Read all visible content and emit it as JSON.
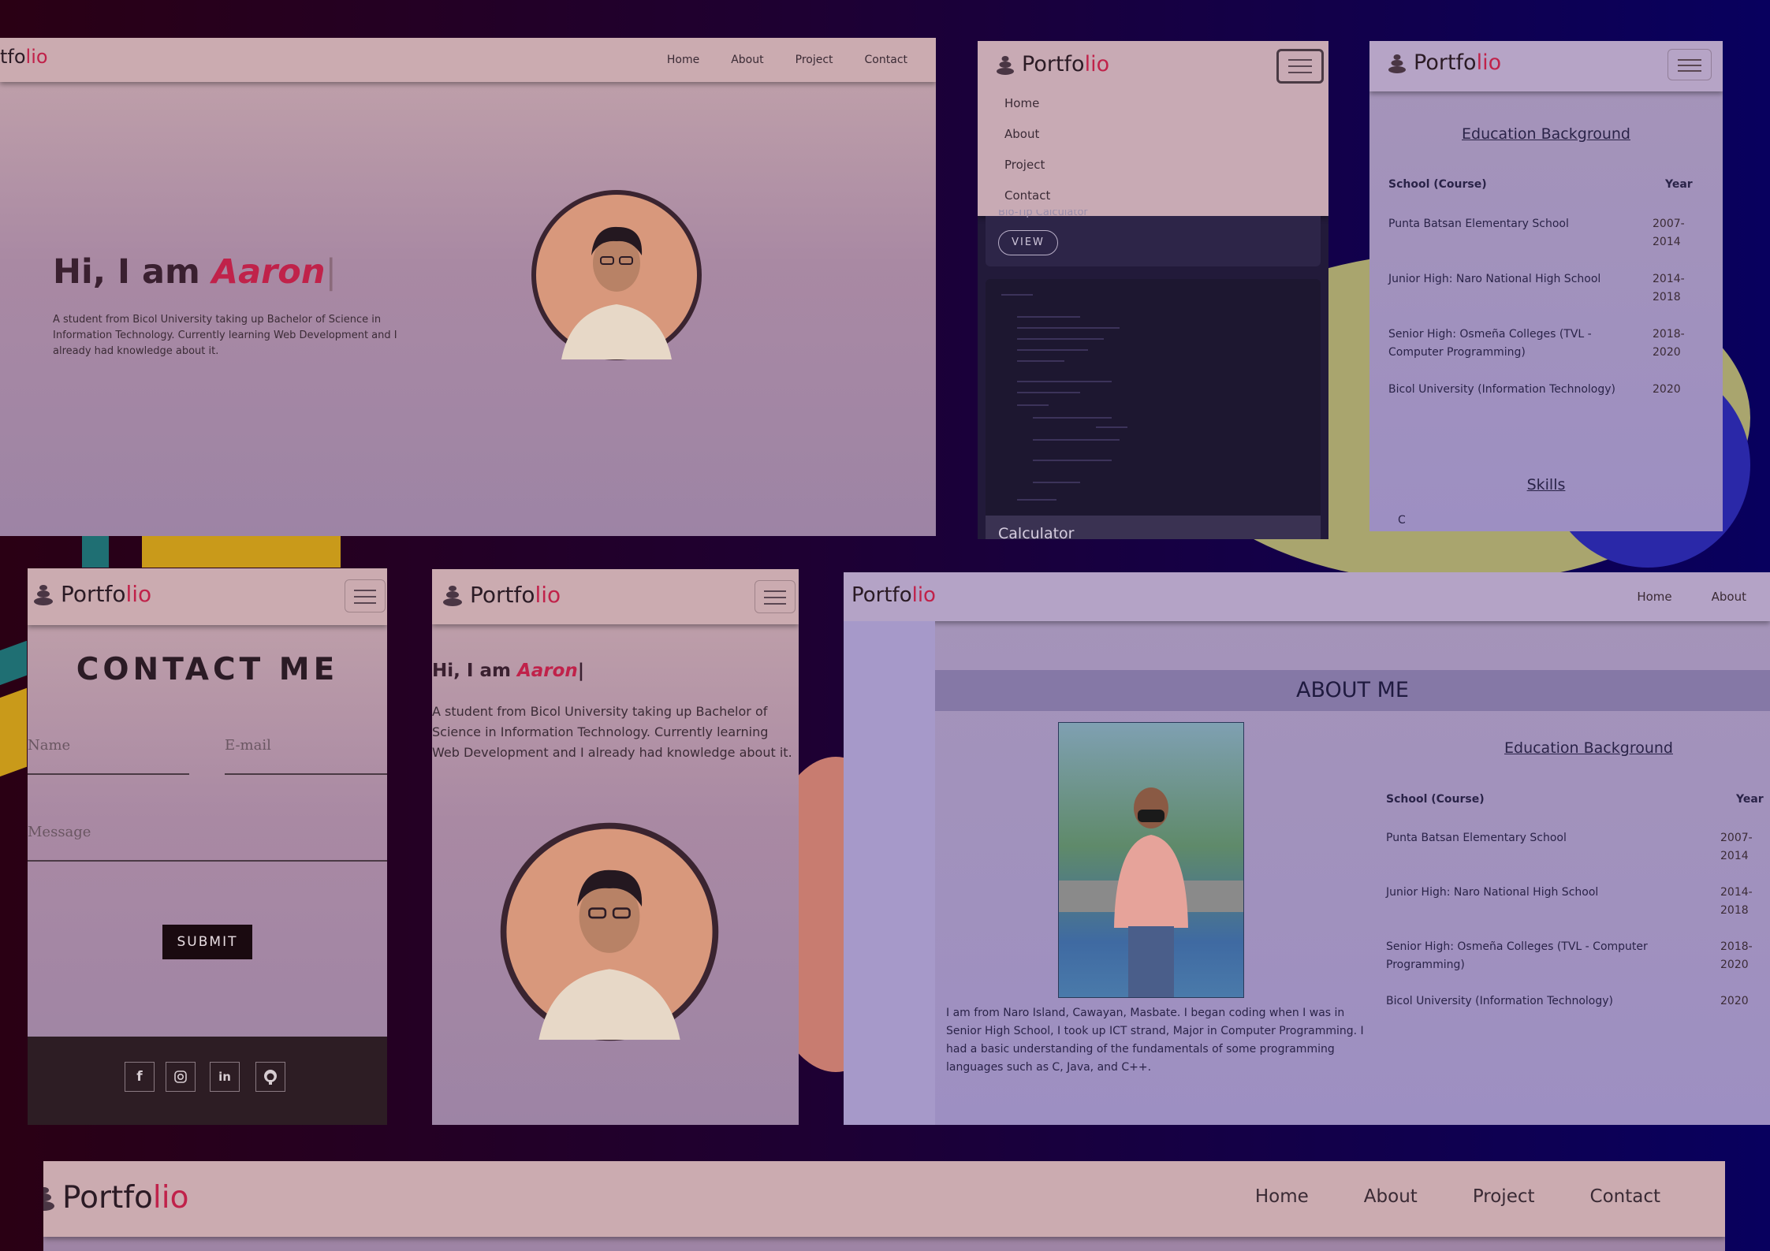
{
  "brand": {
    "prefix": "Portfo",
    "suffix": "lio",
    "cropped_prefix": "tfo"
  },
  "nav": {
    "home": "Home",
    "about": "About",
    "project": "Project",
    "contact": "Contact"
  },
  "hero": {
    "greeting": "Hi, I am ",
    "name": "Aaron",
    "cursor": "|",
    "bio": "A student from Bicol University taking up Bachelor of Science in Information Technology. Currently learning Web Development and I already had knowledge about it."
  },
  "project": {
    "cropped_title": "Bio-Tip Calculator",
    "view_label": "VIEW",
    "next_title": "Calculator"
  },
  "education": {
    "title": "Education Background",
    "col_school": "School (Course)",
    "col_year": "Year",
    "rows": [
      {
        "school": "Punta Batsan Elementary School",
        "year": "2007-2014"
      },
      {
        "school": "Junior High: Naro National High School",
        "year": "2014-2018"
      },
      {
        "school": "Senior High: Osmeña Colleges (TVL - Computer Programming)",
        "year": "2018-2020"
      },
      {
        "school": "Bicol University (Information Technology)",
        "year": "2020"
      }
    ]
  },
  "skills": {
    "title": "Skills",
    "first": "C"
  },
  "contact": {
    "title": "CONTACT ME",
    "name_placeholder": "Name",
    "email_placeholder": "E-mail",
    "message_placeholder": "Message",
    "submit_label": "SUBMIT"
  },
  "social": [
    "facebook-icon",
    "instagram-icon",
    "linkedin-icon",
    "github-icon"
  ],
  "about": {
    "title": "ABOUT ME",
    "bio": "I am from Naro Island, Cawayan, Masbate. I began coding when I was in Senior High School, I took up ICT strand, Major in Computer Programming. I had a basic understanding of the fundamentals of some programming languages such as C, Java, and C++."
  },
  "colors": {
    "accent": "#c0224a",
    "nav": "#cbabb0",
    "footer": "#2d1d24"
  }
}
